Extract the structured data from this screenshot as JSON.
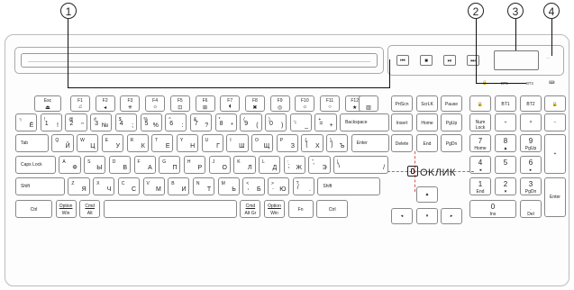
{
  "callouts": [
    "1",
    "2",
    "3",
    "4"
  ],
  "logo": "OKЛИК",
  "media_buttons": [
    "⏮",
    "■",
    "⏯",
    "⏭"
  ],
  "indicators": [
    "🔒",
    "ВТ1",
    "ВТ2",
    "⌨"
  ],
  "fkeys": [
    {
      "name": "Esc",
      "icon": "⏏"
    },
    {
      "name": "F1",
      "icon": "♫"
    },
    {
      "name": "F2",
      "icon": "◂"
    },
    {
      "name": "F3",
      "icon": "✳"
    },
    {
      "name": "F4",
      "icon": "☼"
    },
    {
      "name": "F5",
      "icon": "⊡"
    },
    {
      "name": "F6",
      "icon": "⊞"
    },
    {
      "name": "F7",
      "icon": "⏴"
    },
    {
      "name": "F8",
      "icon": "✖"
    },
    {
      "name": "F9",
      "icon": "◎"
    },
    {
      "name": "F10",
      "icon": "☼"
    },
    {
      "name": "F11",
      "icon": "○"
    },
    {
      "name": "F12",
      "icon": "★"
    },
    {
      "name": "",
      "icon": "▥"
    }
  ],
  "top_right_keys": [
    "PrtScn",
    "ScrLK",
    "Pause",
    "🔒",
    "BT1",
    "BT2",
    "🔒"
  ],
  "row_num": [
    {
      "tl": "~",
      "bl": "`",
      "br": "Ё"
    },
    {
      "tl": "!",
      "bl": "1",
      "br": "!"
    },
    {
      "tl": "@",
      "bl": "2",
      "br": "\""
    },
    {
      "tl": "#",
      "bl": "3",
      "br": "№"
    },
    {
      "tl": "$",
      "bl": "4",
      "br": ";"
    },
    {
      "tl": "%",
      "bl": "5",
      "br": "%"
    },
    {
      "tl": "^",
      "bl": "6",
      "br": ":"
    },
    {
      "tl": "&",
      "bl": "7",
      "br": "?"
    },
    {
      "tl": "*",
      "bl": "8",
      "br": "*"
    },
    {
      "tl": "(",
      "bl": "9",
      "br": "("
    },
    {
      "tl": ")",
      "bl": "0",
      "br": ")"
    },
    {
      "tl": "_",
      "bl": "-",
      "br": "_"
    },
    {
      "tl": "+",
      "bl": "=",
      "br": "+"
    },
    {
      "tl": "Backspace",
      "bl": "",
      "br": ""
    }
  ],
  "row_q": [
    {
      "tl": "Tab",
      "bl": "",
      "br": ""
    },
    {
      "tl": "Q",
      "bl": "",
      "br": "Й"
    },
    {
      "tl": "W",
      "bl": "",
      "br": "Ц"
    },
    {
      "tl": "E",
      "bl": "",
      "br": "У"
    },
    {
      "tl": "R",
      "bl": "",
      "br": "К"
    },
    {
      "tl": "T",
      "bl": "",
      "br": "Е"
    },
    {
      "tl": "Y",
      "bl": "",
      "br": "Н"
    },
    {
      "tl": "U",
      "bl": "",
      "br": "Г"
    },
    {
      "tl": "I",
      "bl": "",
      "br": "Ш"
    },
    {
      "tl": "O",
      "bl": "",
      "br": "Щ"
    },
    {
      "tl": "P",
      "bl": "",
      "br": "З"
    },
    {
      "tl": "{",
      "bl": "[",
      "br": "Х"
    },
    {
      "tl": "}",
      "bl": "]",
      "br": "Ъ"
    },
    {
      "tl": "Enter",
      "bl": "",
      "br": ""
    }
  ],
  "row_a": [
    {
      "tl": "Caps Lock",
      "bl": "",
      "br": ""
    },
    {
      "tl": "A",
      "bl": "",
      "br": "Ф"
    },
    {
      "tl": "S",
      "bl": "",
      "br": "Ы"
    },
    {
      "tl": "D",
      "bl": "",
      "br": "В"
    },
    {
      "tl": "F",
      "bl": "",
      "br": "А"
    },
    {
      "tl": "G",
      "bl": "",
      "br": "П"
    },
    {
      "tl": "H",
      "bl": "",
      "br": "Р"
    },
    {
      "tl": "J",
      "bl": "",
      "br": "О"
    },
    {
      "tl": "K",
      "bl": "",
      "br": "Л"
    },
    {
      "tl": "L",
      "bl": "",
      "br": "Д"
    },
    {
      "tl": ":",
      "bl": ";",
      "br": "Ж"
    },
    {
      "tl": "\"",
      "bl": "'",
      "br": "Э"
    },
    {
      "tl": "|",
      "bl": "\\",
      "br": "/"
    }
  ],
  "row_z": [
    {
      "tl": "Shift",
      "bl": "",
      "br": ""
    },
    {
      "tl": "Z",
      "bl": "",
      "br": "Я"
    },
    {
      "tl": "X",
      "bl": "",
      "br": "Ч"
    },
    {
      "tl": "C",
      "bl": "",
      "br": "С"
    },
    {
      "tl": "V",
      "bl": "",
      "br": "М"
    },
    {
      "tl": "B",
      "bl": "",
      "br": "И"
    },
    {
      "tl": "N",
      "bl": "",
      "br": "Т"
    },
    {
      "tl": "M",
      "bl": "",
      "br": "Ь"
    },
    {
      "tl": "<",
      "bl": ",",
      "br": "Б"
    },
    {
      "tl": ">",
      "bl": ".",
      "br": "Ю"
    },
    {
      "tl": "?",
      "bl": "/",
      "br": "."
    },
    {
      "tl": "Shift",
      "bl": "",
      "br": ""
    }
  ],
  "row_bottom": [
    {
      "tl": "Ctrl",
      "bl": ""
    },
    {
      "tl": "Option",
      "bl": "Win"
    },
    {
      "tl": "Cmd",
      "bl": "Alt"
    },
    {
      "tl": "",
      "bl": ""
    },
    {
      "tl": "Cmd",
      "bl": "Alt Gr"
    },
    {
      "tl": "Option",
      "bl": "Win"
    },
    {
      "tl": "Fn",
      "bl": ""
    },
    {
      "tl": "Ctrl",
      "bl": ""
    }
  ],
  "nav_keys": [
    "Insert",
    "Home",
    "PgUp",
    "Delete",
    "End",
    "PgDn"
  ],
  "arrows": [
    "▲",
    "◂",
    "▾",
    "▸"
  ],
  "numpad": [
    {
      "top": "Num Lock",
      "sub": ""
    },
    {
      "top": "÷",
      "sub": ""
    },
    {
      "top": "×",
      "sub": ""
    },
    {
      "top": "−",
      "sub": ""
    },
    {
      "top": "7",
      "sub": "Home"
    },
    {
      "top": "8",
      "sub": "▲"
    },
    {
      "top": "9",
      "sub": "PgUp"
    },
    {
      "top": "+",
      "sub": ""
    },
    {
      "top": "4",
      "sub": "◂"
    },
    {
      "top": "5",
      "sub": ""
    },
    {
      "top": "6",
      "sub": "▸"
    },
    {
      "top": "1",
      "sub": "End"
    },
    {
      "top": "2",
      "sub": "▾"
    },
    {
      "top": "3",
      "sub": "PgDn"
    },
    {
      "top": "Enter",
      "sub": ""
    },
    {
      "top": "0",
      "sub": "Ins"
    },
    {
      "top": ".",
      "sub": "Del"
    }
  ]
}
